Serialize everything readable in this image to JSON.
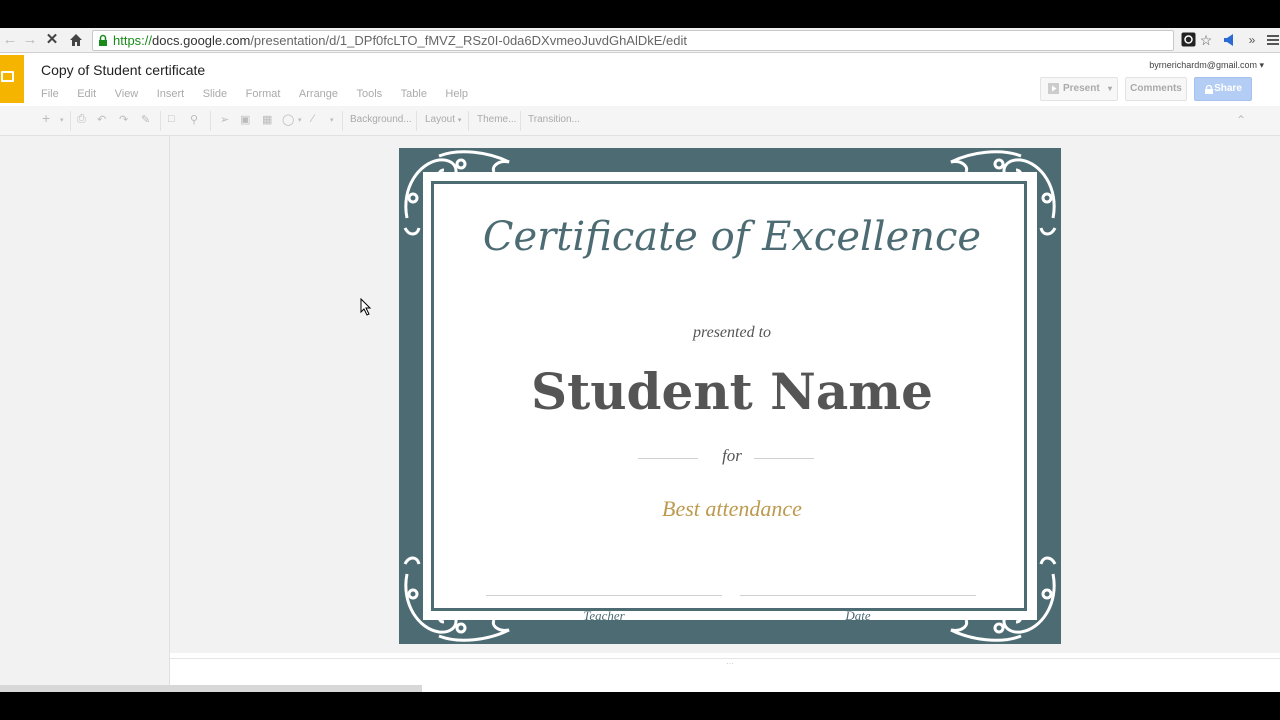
{
  "browser": {
    "url_scheme": "https://",
    "url_host": "docs.google.com",
    "url_path": "/presentation/d/1_DPf0fcLTO_fMVZ_RSz0I-0da6DXvmeoJuvdGhAlDkE/edit",
    "nav_icons": [
      "back-icon",
      "forward-icon",
      "stop-loading-icon",
      "home-icon"
    ],
    "right_icons": [
      "extension-icon",
      "bookmark-star-icon",
      "announcement-icon",
      "overflow-chevron-icon",
      "menu-icon"
    ]
  },
  "app": {
    "doc_title": "Copy of Student certificate",
    "menu": [
      "File",
      "Edit",
      "View",
      "Insert",
      "Slide",
      "Format",
      "Arrange",
      "Tools",
      "Table",
      "Help"
    ],
    "account": "byrnerichardm@gmail.com",
    "present_label": "Present",
    "comments_label": "Comments",
    "share_label": "Share"
  },
  "toolbar": {
    "background_label": "Background...",
    "layout_label": "Layout",
    "theme_label": "Theme...",
    "transition_label": "Transition..."
  },
  "certificate": {
    "title": "Certificate of Excellence",
    "presented_to": "presented to",
    "student_name": "Student Name",
    "for_label": "for",
    "reason": "Best attendance",
    "teacher_label": "Teacher",
    "date_label": "Date"
  },
  "colors": {
    "frame_teal": "#4d6b73",
    "gold": "#bd9a4f",
    "slides_yellow": "#f4b400",
    "share_blue": "#b4cdf4"
  }
}
